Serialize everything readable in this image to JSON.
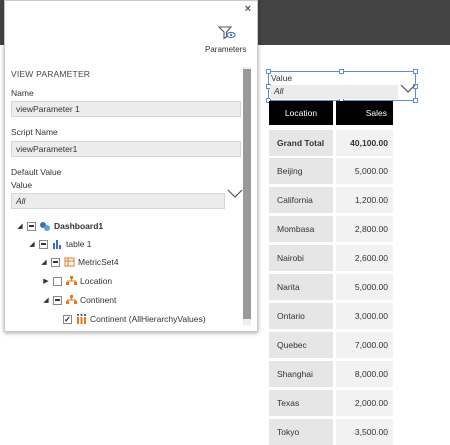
{
  "panel": {
    "close_label": "×",
    "parameters_label": "Parameters",
    "section_title": "VIEW PARAMETER",
    "name_label": "Name",
    "name_value": "viewParameter 1",
    "script_name_label": "Script Name",
    "script_name_value": "viewParameter1",
    "default_value_label": "Default Value",
    "value_label": "Value",
    "value_value": "All",
    "tree": [
      {
        "label": "Dashboard1",
        "bold": true,
        "icon": "dashboard-icon",
        "checkbox": "partial",
        "expanded": true
      },
      {
        "label": "table 1",
        "bold": false,
        "icon": "table-icon",
        "checkbox": "partial",
        "expanded": true
      },
      {
        "label": "MetricSet4",
        "bold": false,
        "icon": "metricset-icon",
        "checkbox": "partial",
        "expanded": true
      },
      {
        "label": "Location",
        "bold": false,
        "icon": "hierarchy-icon",
        "checkbox": "unchecked",
        "expanded": false
      },
      {
        "label": "Continent",
        "bold": false,
        "icon": "hierarchy-icon",
        "checkbox": "partial",
        "expanded": true
      },
      {
        "label": "Continent (AllHierarchyValues)",
        "bold": false,
        "icon": "values-icon",
        "checkbox": "checked",
        "expanded": null
      }
    ]
  },
  "value_widget": {
    "label": "Value",
    "value": "All"
  },
  "grid": {
    "headers": [
      "Location",
      "Sales"
    ],
    "total_label": "Grand Total",
    "total_value": "40,100.00",
    "rows": [
      {
        "location": "Beijing",
        "sales": "5,000.00"
      },
      {
        "location": "California",
        "sales": "1,200.00"
      },
      {
        "location": "Mombasa",
        "sales": "2,800.00"
      },
      {
        "location": "Nairobi",
        "sales": "2,600.00"
      },
      {
        "location": "Narita",
        "sales": "5,000.00"
      },
      {
        "location": "Ontario",
        "sales": "3,000.00"
      },
      {
        "location": "Quebec",
        "sales": "7,000.00"
      },
      {
        "location": "Shanghai",
        "sales": "8,000.00"
      },
      {
        "location": "Texas",
        "sales": "2,000.00"
      },
      {
        "location": "Tokyo",
        "sales": "3,500.00"
      }
    ]
  },
  "colors": {
    "topbar": "#444444",
    "header_bg": "#000000",
    "selection": "#5a8fd6",
    "dashboard_icon": "#3a6fb8",
    "table_icon": "#3a6fb8",
    "hierarchy_icon": "#e07a1f"
  }
}
